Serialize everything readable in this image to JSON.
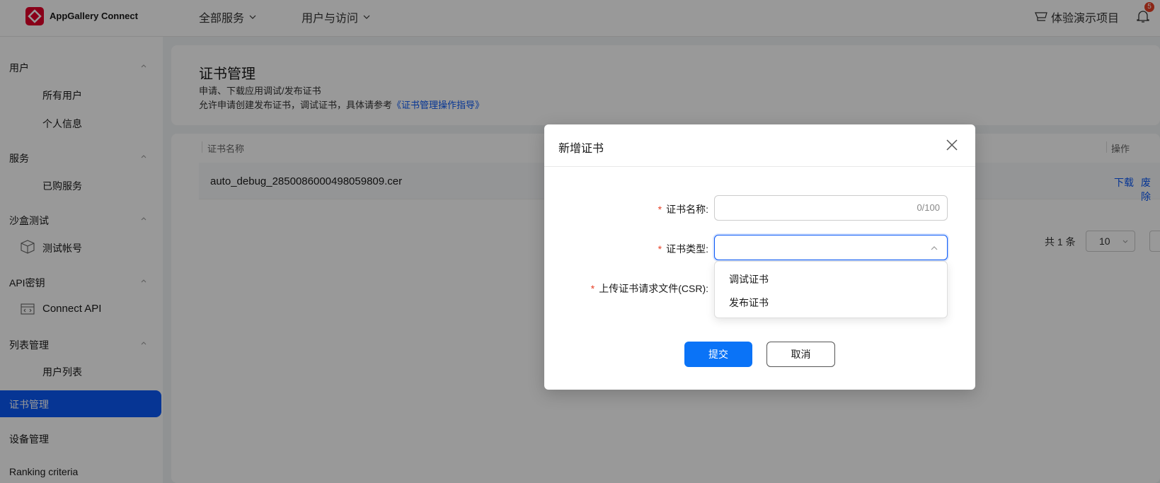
{
  "header": {
    "brand": "AppGallery Connect",
    "nav": [
      "全部服务",
      "用户与访问"
    ],
    "project": "体验演示项目",
    "notifications": "5"
  },
  "sidebar": {
    "sections": [
      {
        "label": "用户",
        "items": [
          "所有用户",
          "个人信息"
        ]
      },
      {
        "label": "服务",
        "items": [
          "已购服务"
        ]
      },
      {
        "label": "沙盒测试",
        "items": [
          "测试帐号"
        ]
      },
      {
        "label": "API密钥",
        "items": [
          "Connect API"
        ]
      },
      {
        "label": "列表管理",
        "items": [
          "用户列表"
        ]
      }
    ],
    "active": "证书管理",
    "more": [
      "设备管理",
      "Ranking criteria"
    ]
  },
  "page": {
    "title": "证书管理",
    "desc1": "申请、下载应用调试/发布证书",
    "desc2": "允许申请创建发布证书，调试证书，具体请参考",
    "desc2_link": "《证书管理操作指导》"
  },
  "table": {
    "headers": [
      "证书名称",
      "操作"
    ],
    "rows": [
      {
        "name": "auto_debug_2850086000498059809.cer",
        "ops": [
          "下载",
          "废除"
        ]
      }
    ],
    "total": "共 1 条",
    "page_size": "10"
  },
  "modal": {
    "title": "新增证书",
    "fields": {
      "name_label": "证书名称:",
      "name_counter": "0/100",
      "type_label": "证书类型:",
      "csr_label": "上传证书请求文件(CSR):"
    },
    "type_options": [
      "调试证书",
      "发布证书"
    ],
    "submit": "提交",
    "cancel": "取消"
  },
  "colors": {
    "primary": "#0a59f7",
    "required": "#e84026"
  }
}
